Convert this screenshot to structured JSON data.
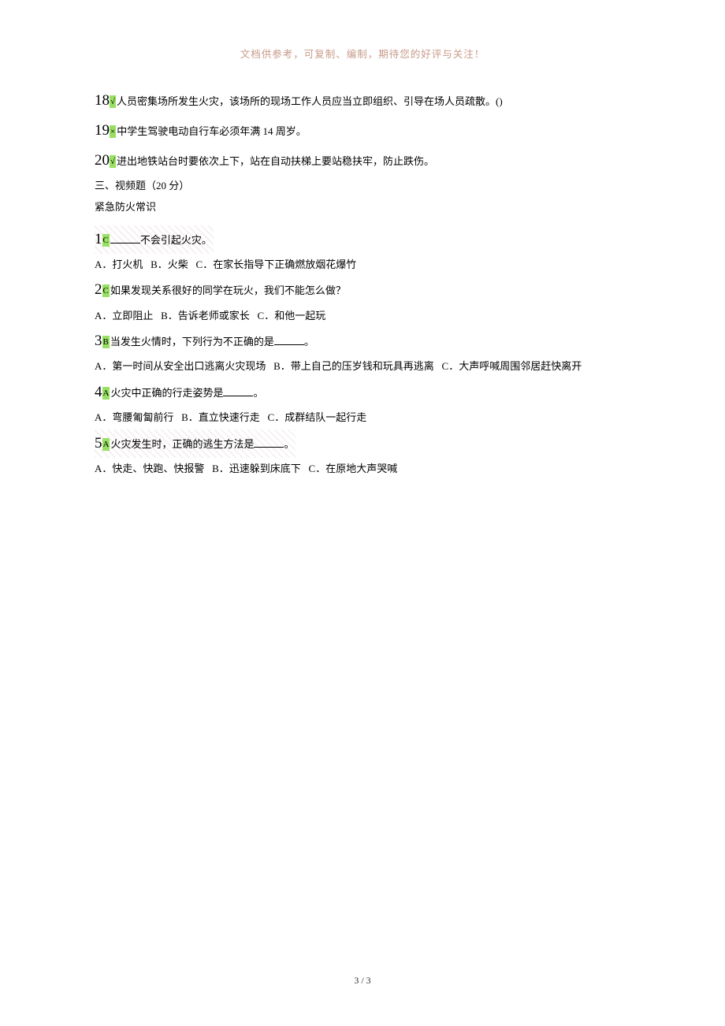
{
  "header": {
    "note": "文档供参考，可复制、编制，期待您的好评与关注！"
  },
  "tf": [
    {
      "n": "18",
      "mark": "√",
      "text": "人员密集场所发生火灾，该场所的现场工作人员应当立即组织、引导在场人员疏散。()"
    },
    {
      "n": "19",
      "mark": "×",
      "text": "中学生驾驶电动自行车必须年满 14 周岁。"
    },
    {
      "n": "20",
      "mark": "√",
      "text": "进出地铁站台时要依次上下，站在自动扶梯上要站稳扶牢，防止跌伤。"
    }
  ],
  "section": {
    "title": "三、视频题（20 分）",
    "subtitle": "紧急防火常识"
  },
  "mc": [
    {
      "n": "1",
      "mark": "C",
      "stem_before": "",
      "stem_after": "不会引起火灾。",
      "opts": "A．打火机   B．火柴   C．在家长指导下正确燃放烟花爆竹",
      "fill": true,
      "striped": true
    },
    {
      "n": "2",
      "mark": "C",
      "stem_before": "如果发现关系很好的同学在玩火，我们不能怎么做？",
      "stem_after": "",
      "opts": "A．立即阻止   B．告诉老师或家长   C．和他一起玩",
      "fill": false,
      "striped": false
    },
    {
      "n": "3",
      "mark": "B",
      "stem_before": "当发生火情时，下列行为不正确的是",
      "stem_after": "。",
      "opts": "A．第一时间从安全出口逃离火灾现场   B．带上自己的压岁钱和玩具再逃离   C．大声呼喊周围邻居赶快离开",
      "fill": true,
      "striped": false
    },
    {
      "n": "4",
      "mark": "A",
      "stem_before": "火灾中正确的行走姿势是",
      "stem_after": "。",
      "opts": "A．弯腰匍匐前行   B．直立快速行走   C．成群结队一起行走",
      "fill": true,
      "striped": false
    },
    {
      "n": "5",
      "mark": "A",
      "stem_before": "火灾发生时，正确的逃生方法是",
      "stem_after": "。",
      "opts": "A．快走、快跑、快报警   B．迅速躲到床底下   C．在原地大声哭喊",
      "fill": true,
      "striped": true
    }
  ],
  "footer": {
    "page": "3 / 3"
  }
}
